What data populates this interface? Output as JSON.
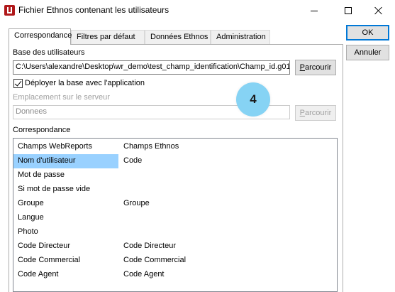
{
  "window": {
    "title": "Fichier Ethnos contenant les utilisateurs",
    "icon": "ethnos-app-icon"
  },
  "tabs": [
    {
      "label": "Correspondance",
      "active": true
    },
    {
      "label": "Filtres par défaut",
      "active": false
    },
    {
      "label": "Données Ethnos",
      "active": false
    },
    {
      "label": "Administration",
      "active": false
    }
  ],
  "buttons": {
    "ok": "OK",
    "annuler": "Annuler"
  },
  "base": {
    "label": "Base des utilisateurs",
    "path": "C:\\Users\\alexandre\\Desktop\\wr_demo\\test_champ_identification\\Champ_id.g01",
    "browse_prefix": "P",
    "browse_rest": "arcourir"
  },
  "deploy": {
    "label": "Déployer la base avec l'application",
    "checked": true
  },
  "server": {
    "label": "Emplacement sur le serveur",
    "value": "Donnees",
    "browse_prefix": "P",
    "browse_rest": "arcourir"
  },
  "mapping": {
    "label": "Correspondance",
    "rows": [
      {
        "webreports": "Champs WebReports",
        "ethnos": "Champs Ethnos",
        "selected": false
      },
      {
        "webreports": "Nom d'utilisateur",
        "ethnos": "Code",
        "selected": true
      },
      {
        "webreports": "Mot de passe",
        "ethnos": "",
        "selected": false
      },
      {
        "webreports": "Si mot de passe vide",
        "ethnos": "",
        "selected": false
      },
      {
        "webreports": "Groupe",
        "ethnos": "Groupe",
        "selected": false
      },
      {
        "webreports": "Langue",
        "ethnos": "",
        "selected": false
      },
      {
        "webreports": "Photo",
        "ethnos": "",
        "selected": false
      },
      {
        "webreports": "Code Directeur",
        "ethnos": "Code Directeur",
        "selected": false
      },
      {
        "webreports": "Code Commercial",
        "ethnos": "Code Commercial",
        "selected": false
      },
      {
        "webreports": "Code Agent",
        "ethnos": "Code Agent",
        "selected": false
      }
    ]
  },
  "step_badge": "4",
  "colors": {
    "selection": "#99d1ff",
    "badge": "#86d3f4",
    "default_button_border": "#0078d7"
  }
}
